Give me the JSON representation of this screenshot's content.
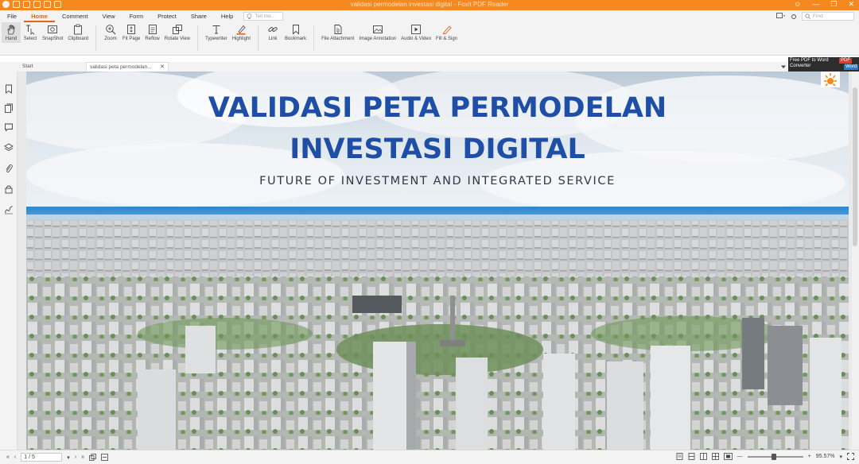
{
  "window": {
    "title": "validasi permodelan investasi digital - Foxit PDF Reader",
    "controls": [
      "☺",
      "—",
      "❐",
      "✕"
    ]
  },
  "menu": {
    "items": [
      "File",
      "Home",
      "Comment",
      "View",
      "Form",
      "Protect",
      "Share",
      "Help"
    ],
    "active_index": 1,
    "tell_me_placeholder": "Tell me...",
    "find_placeholder": "Find"
  },
  "ribbon": {
    "tools": [
      {
        "label": "Hand",
        "icon": "hand-icon"
      },
      {
        "label": "Select",
        "icon": "select-icon"
      },
      {
        "label": "SnapShot",
        "icon": "snapshot-icon"
      },
      {
        "label": "Clipboard",
        "icon": "clipboard-icon"
      },
      {
        "label": "Zoom",
        "icon": "zoom-icon"
      },
      {
        "label": "Fit Page",
        "icon": "fit-page-icon"
      },
      {
        "label": "Reflow",
        "icon": "reflow-icon"
      },
      {
        "label": "Rotate View",
        "icon": "rotate-view-icon"
      },
      {
        "label": "Typewriter",
        "icon": "typewriter-icon"
      },
      {
        "label": "Highlight",
        "icon": "highlight-icon"
      },
      {
        "label": "Link",
        "icon": "link-icon"
      },
      {
        "label": "Bookmark",
        "icon": "bookmark-icon"
      },
      {
        "label": "File Attachment",
        "icon": "file-attachment-icon"
      },
      {
        "label": "Image Annotation",
        "icon": "image-annotation-icon"
      },
      {
        "label": "Audio & Video",
        "icon": "audio-video-icon"
      },
      {
        "label": "Fill & Sign",
        "icon": "fill-sign-icon"
      }
    ]
  },
  "tabs": {
    "start": "Start",
    "document": "validasi peta permodelan..."
  },
  "ad": {
    "line1": "Free PDF to Word",
    "line2": "Converter",
    "pdf_badge": "PDF",
    "word_badge": "Word"
  },
  "page": {
    "title_line1": "VALIDASI PETA PERMODELAN",
    "title_line2": "INVESTASI DIGITAL",
    "subtitle": "FUTURE OF INVESTMENT AND INTEGRATED SERVICE",
    "title_color": "#1e4ea5"
  },
  "status": {
    "page_indicator": "1 / 5",
    "zoom": "95.57%",
    "zoom_fraction": 0.48
  },
  "colors": {
    "accent": "#e0661a",
    "titlebar": "#f5891f"
  }
}
